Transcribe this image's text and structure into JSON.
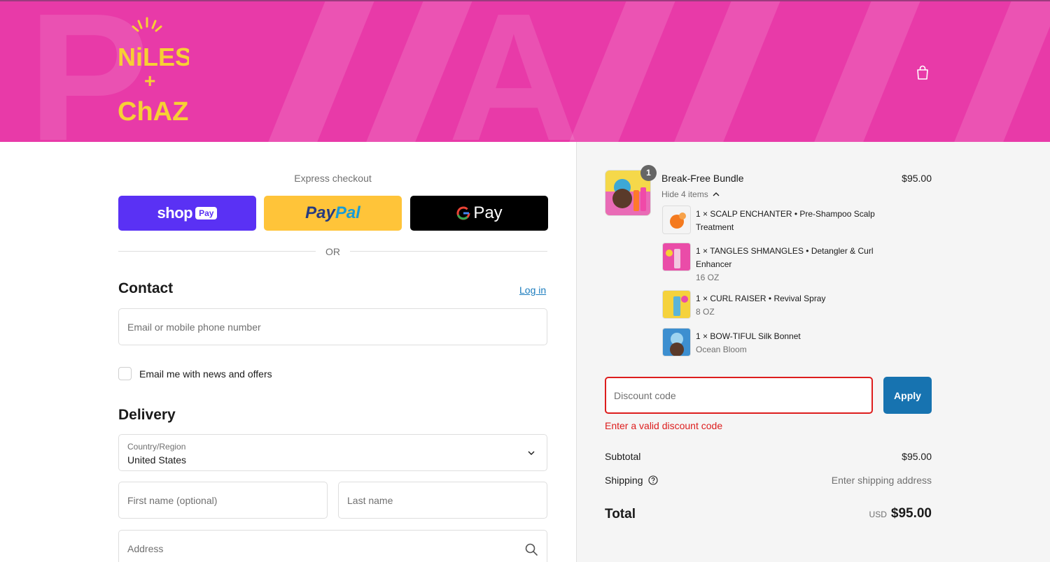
{
  "brand": {
    "logo_line1": "NiLES",
    "logo_plus": "+",
    "logo_line2": "ChAZ",
    "header_color": "#e83aa8",
    "logo_color": "#f7d034"
  },
  "header": {
    "cart_icon": "shopping-bag-icon"
  },
  "express": {
    "title": "Express checkout",
    "shop_pay": {
      "shop": "shop",
      "pay": "Pay"
    },
    "paypal": {
      "pay": "Pay",
      "pal": "Pal"
    },
    "gpay": {
      "g": "G",
      "pay": "Pay"
    },
    "divider": "OR"
  },
  "contact": {
    "title": "Contact",
    "login_label": "Log in",
    "email_placeholder": "Email or mobile phone number",
    "newsletter_label": "Email me with news and offers"
  },
  "delivery": {
    "title": "Delivery",
    "country_label": "Country/Region",
    "country_value": "United States",
    "first_name_placeholder": "First name (optional)",
    "last_name_placeholder": "Last name",
    "address_placeholder": "Address"
  },
  "summary": {
    "bundle": {
      "quantity": "1",
      "name": "Break-Free Bundle",
      "price": "$95.00",
      "toggle_label": "Hide 4 items"
    },
    "items": [
      {
        "line1": "1 × SCALP ENCHANTER • Pre-Shampoo Scalp",
        "line2": "Treatment",
        "variant": ""
      },
      {
        "line1": "1 × TANGLES SHMANGLES • Detangler & Curl",
        "line2": "Enhancer",
        "variant": "16 OZ"
      },
      {
        "line1": "1 × CURL RAISER • Revival Spray",
        "line2": "",
        "variant": "8 OZ"
      },
      {
        "line1": "1 × BOW-TIFUL Silk Bonnet",
        "line2": "",
        "variant": "Ocean Bloom"
      }
    ],
    "discount": {
      "placeholder": "Discount code",
      "apply_label": "Apply",
      "error": "Enter a valid discount code",
      "error_color": "#dd1d1d"
    },
    "subtotal_label": "Subtotal",
    "subtotal_value": "$95.00",
    "shipping_label": "Shipping",
    "shipping_value": "Enter shipping address",
    "total_label": "Total",
    "total_currency": "USD",
    "total_value": "$95.00"
  }
}
